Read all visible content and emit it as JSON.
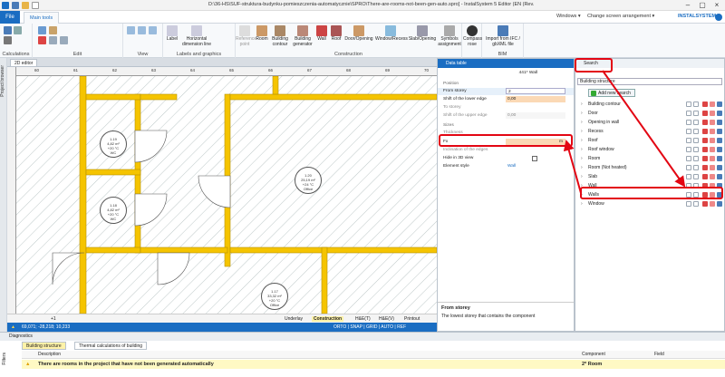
{
  "window": {
    "title": "D:\\36-HS\\SUF-struktura-budynku-pomieszczenia-automatycznie\\SPRO\\There-are-rooms-not-been-gen-auto.spro] - InstalSystem 5 Editor (EN (Rev. 19.6)",
    "windows_menu": "Windows ▾",
    "arrangement_menu": "Change screen arrangement ▾",
    "brand": "INSTALSYSTEM"
  },
  "tabs": {
    "file": "File",
    "main": "Main tools"
  },
  "ribbon": {
    "groups": {
      "calculations": "Calculations",
      "edit": "Edit",
      "view": "View",
      "labels": "Labels and graphics",
      "construction": "Construction",
      "bim": "BIM"
    },
    "buttons": {
      "label": "Label",
      "horiz_dim": "Horizontal dimension line",
      "ref_point": "Reference point",
      "room": "Room",
      "building_contour": "Building contour",
      "building_generator": "Building generator",
      "wall": "Wall",
      "roof": "Roof",
      "door_opening": "Door/Opening",
      "window_recess": "Window/Recess",
      "slab_opening": "Slab/Opening",
      "symbols_assignment": "Symbols assignment",
      "compass_rose": "Compass rose",
      "import_ifc": "Import from IFC / gbXML file"
    }
  },
  "left_strip": {
    "label": "Project browser"
  },
  "editor": {
    "tab": "2D editor",
    "ruler_ticks": [
      "60",
      "61",
      "62",
      "63",
      "64",
      "65",
      "66",
      "67",
      "68",
      "69",
      "70"
    ],
    "rooms": [
      {
        "num": "1.19",
        "area": "4,82 m²",
        "temp": "+20 °C",
        "name": "WC"
      },
      {
        "num": "1.18",
        "area": "4,82 m²",
        "temp": "+20 °C",
        "name": "WC"
      },
      {
        "num": "1.20",
        "area": "25,19 m²",
        "temp": "+24 °C",
        "name": "Office"
      },
      {
        "num": "1.17",
        "area": "33,32 m²",
        "temp": "+20 °C",
        "name": "Office"
      }
    ],
    "bottom_tabs": [
      "Underlay",
      "Construction",
      "H&E(T)",
      "H&E(V)",
      "Printout"
    ],
    "scale_value": "+1",
    "status_coords": "69,071; -28,218; 10,233",
    "status_modes": "ORTO | SNAP | GRID | AUTO | REF"
  },
  "data_table": {
    "title": "Data table",
    "object": "441* Wall",
    "sections": {
      "position": "Position",
      "sizes": "Sizes"
    },
    "rows": {
      "from_storey": {
        "label": "From storey",
        "value": "2"
      },
      "shift_lower": {
        "label": "Shift of the lower edge",
        "value": "0,00",
        "unit": "m"
      },
      "to_storey": {
        "label": "To storey",
        "value": ""
      },
      "shift_upper": {
        "label": "Shift of the upper edge",
        "value": "0,00",
        "unit": "m"
      },
      "thickness": {
        "label": "Thickness",
        "value": ""
      },
      "fx": {
        "label": "Fx",
        "value": "",
        "unit": "m"
      },
      "inclination": {
        "label": "Inclination of the edges",
        "value": ""
      },
      "hide3d": {
        "label": "Hide in 3D view",
        "value": ""
      },
      "element_style": {
        "label": "Element style",
        "value": "Wall"
      }
    },
    "help_title": "From storey",
    "help_text": "The lowest storey that contains the component"
  },
  "search_panel": {
    "title": "Search",
    "dropdown": "Building structure",
    "add_button": "Add new search",
    "items": [
      "Building contour",
      "Door",
      "Opening in wall",
      "Recess",
      "Roof",
      "Roof window",
      "Room",
      "Room (Not heated)",
      "Slab",
      "Wall",
      "Walls",
      "Window"
    ]
  },
  "diagnostics": {
    "title": "Diagnostics",
    "tabs": [
      "Building structure",
      "Thermal calculations of building"
    ],
    "columns": {
      "description": "Description",
      "component": "Component",
      "field": "Field"
    },
    "row": {
      "description": "There are rooms in the project that have not been generated automatically",
      "component": "2* Room",
      "field": ""
    },
    "side_label": "Filters"
  },
  "colors": {
    "accent": "#1a6dc2",
    "wall_highlight": "#f5c400",
    "annotation": "#e30613",
    "warning_row": "#fff9c4"
  }
}
